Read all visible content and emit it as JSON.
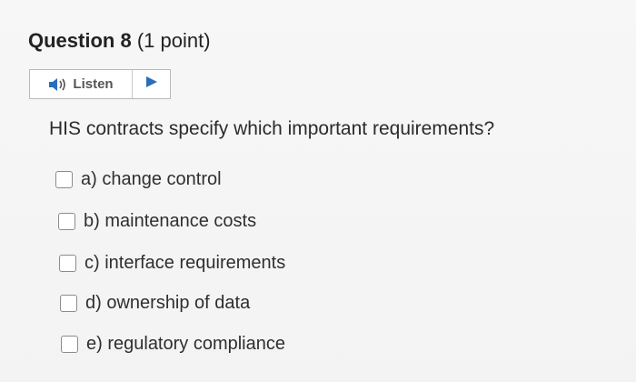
{
  "question": {
    "title": "Question 8",
    "points": "(1 point)"
  },
  "listen": {
    "label": "Listen",
    "speaker_icon": "speaker-icon",
    "play_icon": "play-icon",
    "accent_color": "#2a6ebb"
  },
  "prompt": "HIS contracts specify which important requirements?",
  "options": [
    {
      "label": "a) change control",
      "checked": false
    },
    {
      "label": "b) maintenance costs",
      "checked": false
    },
    {
      "label": "c) interface requirements",
      "checked": false
    },
    {
      "label": "d) ownership of data",
      "checked": false
    },
    {
      "label": "e) regulatory compliance",
      "checked": false
    }
  ]
}
